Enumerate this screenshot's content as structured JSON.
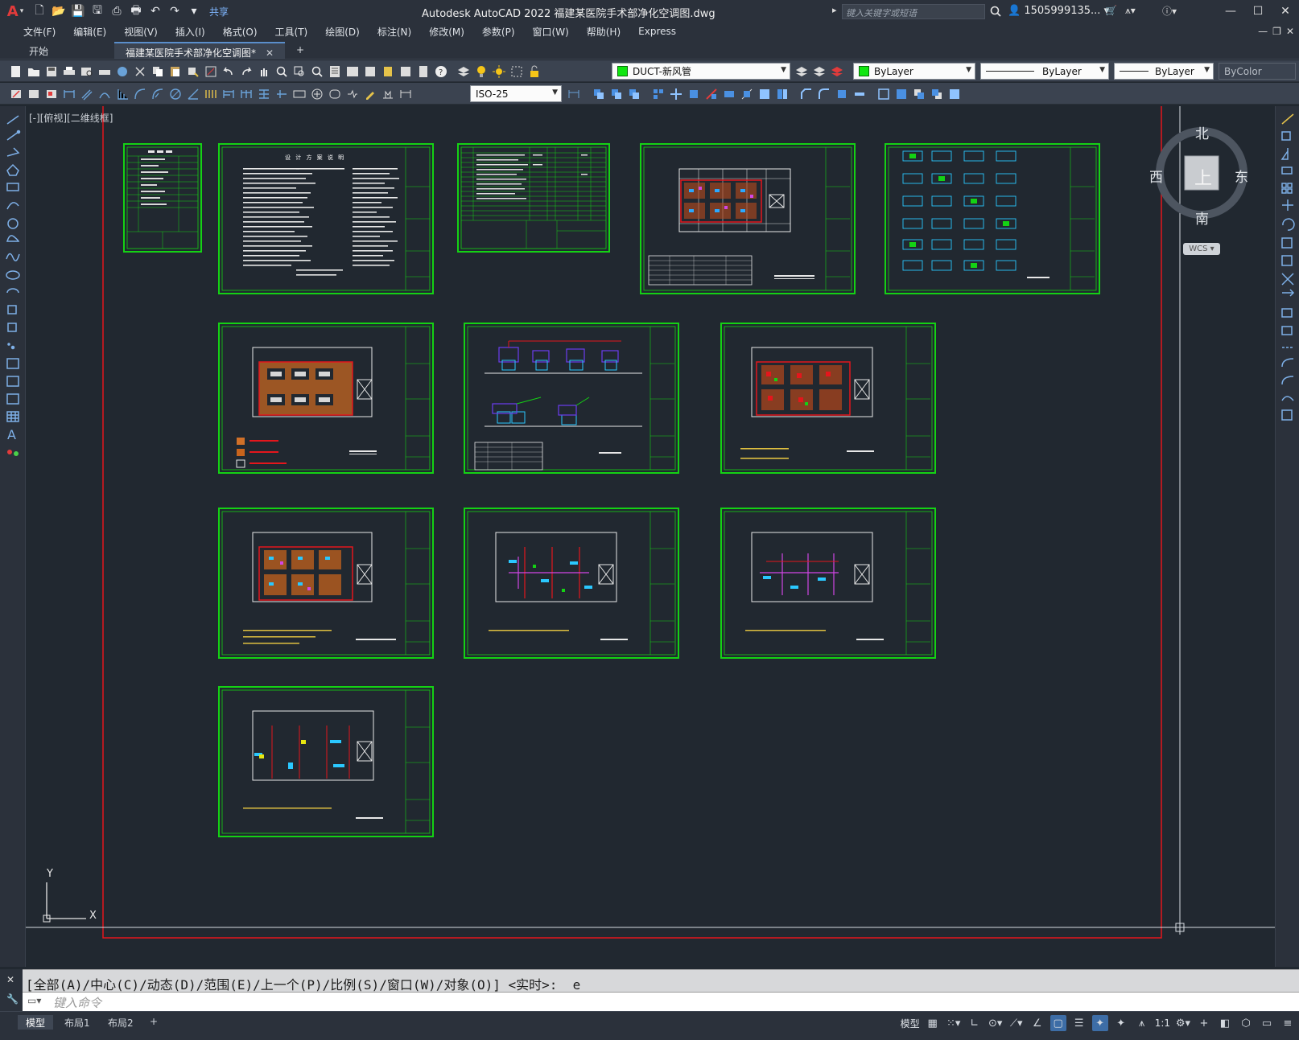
{
  "app": {
    "title": "Autodesk AutoCAD 2022    福建某医院手术部净化空调图.dwg",
    "search_placeholder": "键入关键字或短语",
    "user": "1505999135...",
    "share_label": "共享"
  },
  "menu": [
    "文件(F)",
    "编辑(E)",
    "视图(V)",
    "插入(I)",
    "格式(O)",
    "工具(T)",
    "绘图(D)",
    "标注(N)",
    "修改(M)",
    "参数(P)",
    "窗口(W)",
    "帮助(H)",
    "Express"
  ],
  "tabs": [
    {
      "label": "开始"
    },
    {
      "label": "福建某医院手术部净化空调图*"
    }
  ],
  "toolbar": {
    "layer": "DUCT-新风管",
    "color": "ByLayer",
    "linetype": "ByLayer",
    "lineweight": "ByLayer",
    "plotstyle": "ByColor",
    "dimstyle": "ISO-25"
  },
  "viewport": {
    "label": "[-][俯视][二维线框]"
  },
  "viewcube": {
    "north": "北",
    "south": "南",
    "east": "东",
    "west": "西",
    "top": "上",
    "wcs": "WCS"
  },
  "ucs": {
    "x": "X",
    "y": "Y"
  },
  "drawing": {
    "sheet1_title": "设 计 方 案 说 明"
  },
  "command": {
    "history": "[全部(A)/中心(C)/动态(D)/范围(E)/上一个(P)/比例(S)/窗口(W)/对象(O)] <实时>: _e",
    "placeholder": "键入命令"
  },
  "layouts": [
    "模型",
    "布局1",
    "布局2"
  ],
  "status": {
    "model_label": "模型",
    "scale": "1:1"
  },
  "colors": {
    "frame_green": "#14d214",
    "drawing_red": "#e4161c",
    "canvas_bg": "#212830",
    "accent_blue": "#3d6da6"
  }
}
